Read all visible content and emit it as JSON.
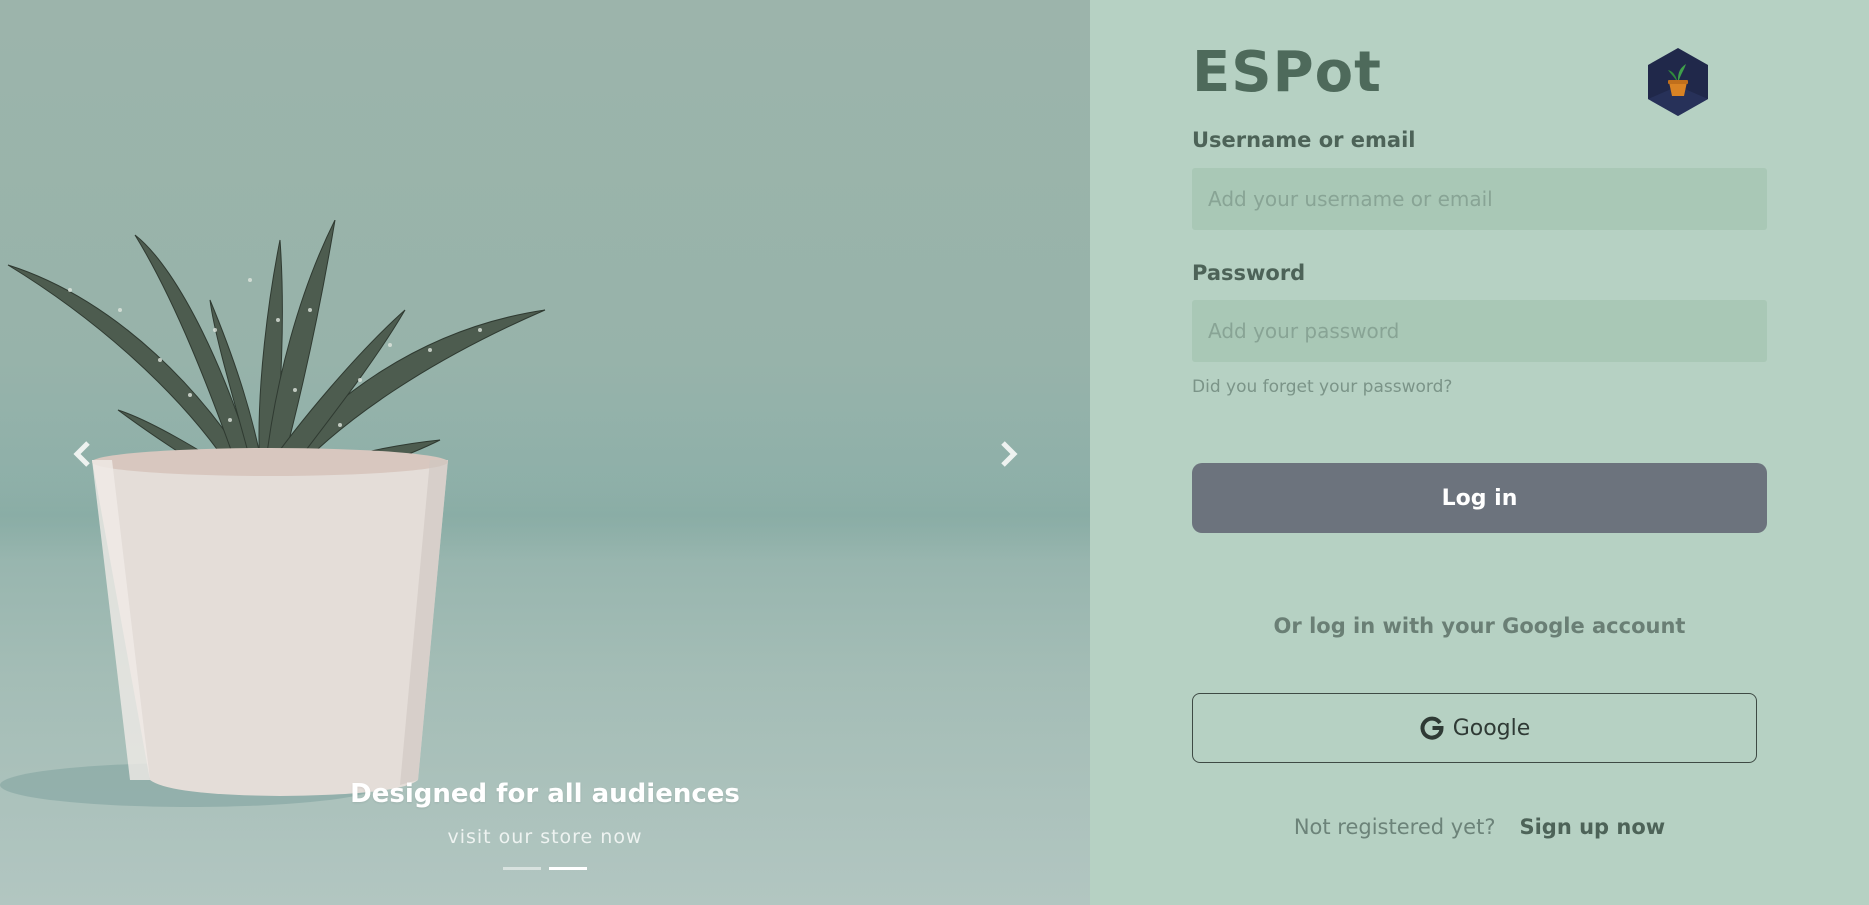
{
  "carousel": {
    "slide_title": "Designed for all audiences",
    "slide_subtitle": "visit our store now",
    "prev_label": "‹",
    "next_label": "›",
    "indicators": [
      "slide-1",
      "slide-2"
    ],
    "active_indicator": 2
  },
  "login": {
    "brand": "ESPot",
    "logo_icon": "potted-plant-hexagon-icon",
    "username": {
      "label": "Username or email",
      "placeholder": "Add your username or email",
      "value": ""
    },
    "password": {
      "label": "Password",
      "placeholder": "Add your password",
      "value": ""
    },
    "forgot_password": "Did you forget your password?",
    "login_button": "Log in",
    "alt_login_text": "Or log in with your Google account",
    "google_button": "Google",
    "signup_prompt": "Not registered yet?",
    "signup_link": "Sign up now"
  },
  "colors": {
    "panel_bg": "#b6d1c3",
    "field_bg": "#a9c8b6",
    "login_button_bg": "#6c737d",
    "brand_text": "#4e6a5b"
  }
}
